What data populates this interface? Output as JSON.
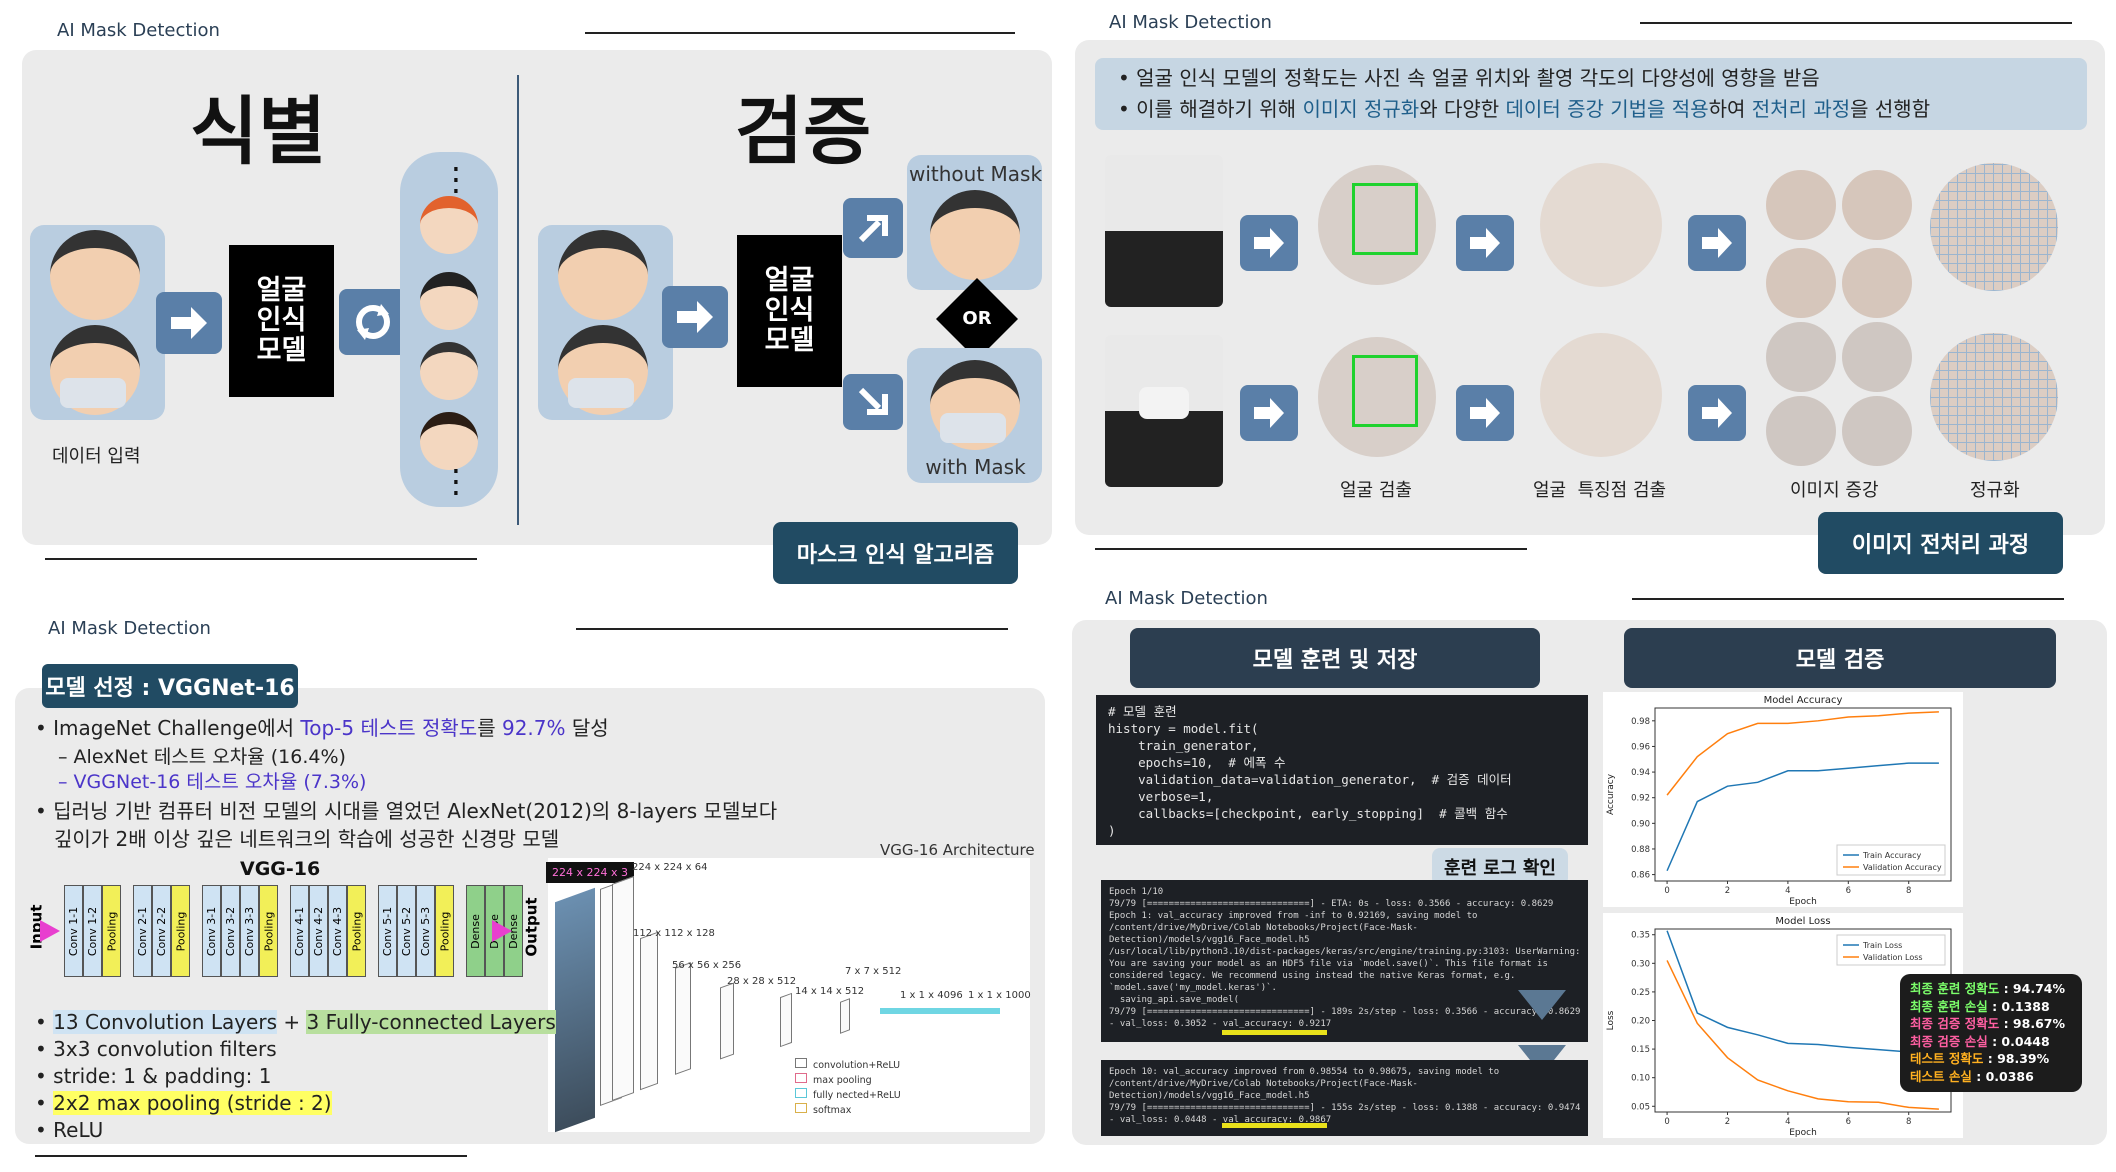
{
  "header_label": "AI Mask Detection",
  "q1": {
    "title_left": "식별",
    "title_right": "검증",
    "model_box": "얼굴\n인식\n모델",
    "data_input_label": "데이터 입력",
    "without_mask": "without Mask",
    "with_mask": "with Mask",
    "or_label": "OR",
    "dots": "⋮",
    "footer_button": "마스크 인식 알고리즘"
  },
  "q2": {
    "bullet1": "얼굴 인식 모델의 정확도는 사진 속 얼굴 위치와 촬영 각도의 다양성에 영향을 받음",
    "bullet2_parts": [
      "이를 해결하기 위해 ",
      "이미지 정규화",
      "와 다양한 ",
      "데이터 증강 기법을 적용",
      "하여 ",
      "전처리 과정",
      "을 선행함"
    ],
    "labels": [
      "얼굴 검출",
      "얼굴  특징점 검출",
      "이미지 증강",
      "정규화"
    ],
    "footer_button": "이미지 전처리 과정",
    "colors": {
      "highlight": "#1f5f8b"
    }
  },
  "q3": {
    "model_title": "모델 선정 : VGGNet-16",
    "b1_parts": [
      "ImageNet Challenge에서 ",
      "Top-5 테스트 정확도",
      "를 ",
      "92.7%",
      " 달성"
    ],
    "sub1": "AlexNet 테스트 오차율 (16.4%)",
    "sub2": "VGGNet-16 테스트 오차율 (7.3%)",
    "b2_line1": "딥러닝 기반 컴퓨터 비전 모델의 시대를 열었던 AlexNet(2012)의 8-layers 모델보다",
    "b2_line2": "깊이가 2배 이상 깊은 네트워크의 학습에 성공한 신경망 모델",
    "vgg_title": "VGG-16",
    "arch_title": "VGG-16 Architecture",
    "input_label": "Input",
    "output_label": "Output",
    "layers": [
      {
        "name": "Conv 1-1",
        "kind": "conv"
      },
      {
        "name": "Conv 1-2",
        "kind": "conv"
      },
      {
        "name": "Pooling",
        "kind": "pool"
      },
      {
        "name": "Conv 2-1",
        "kind": "conv"
      },
      {
        "name": "Conv 2-2",
        "kind": "conv"
      },
      {
        "name": "Pooling",
        "kind": "pool"
      },
      {
        "name": "Conv 3-1",
        "kind": "conv"
      },
      {
        "name": "Conv 3-2",
        "kind": "conv"
      },
      {
        "name": "Conv 3-3",
        "kind": "conv"
      },
      {
        "name": "Pooling",
        "kind": "pool"
      },
      {
        "name": "Conv 4-1",
        "kind": "conv"
      },
      {
        "name": "Conv 4-2",
        "kind": "conv"
      },
      {
        "name": "Conv 4-3",
        "kind": "conv"
      },
      {
        "name": "Pooling",
        "kind": "pool"
      },
      {
        "name": "Conv 5-1",
        "kind": "conv"
      },
      {
        "name": "Conv 5-2",
        "kind": "conv"
      },
      {
        "name": "Conv 5-3",
        "kind": "conv"
      },
      {
        "name": "Pooling",
        "kind": "pool"
      },
      {
        "name": "Dense",
        "kind": "dense"
      },
      {
        "name": "Dense",
        "kind": "dense"
      },
      {
        "name": "Dense",
        "kind": "dense"
      }
    ],
    "arch_dims": [
      "224 x 224 x 3",
      "224 x 224 x 64",
      "112 x 112 x 128",
      "56 x 56 x 256",
      "28 x 28 x 512",
      "14 x 14 x 512",
      "7 x 7 x 512",
      "1 x 1 x 4096",
      "1 x 1 x 1000"
    ],
    "legend": [
      "convolution+ReLU",
      "max pooling",
      "fully nected+ReLU",
      "softmax"
    ],
    "b3_a": "13 Convolution Layers",
    "b3_plus": " + ",
    "b3_b": "3 Fully-connected Layers",
    "b4": "3x3 convolution filters",
    "b5": "stride: 1 & padding: 1",
    "b6": "2x2 max pooling (stride : 2)",
    "b7": "ReLU"
  },
  "q4": {
    "btn_train": "모델 훈련 및 저장",
    "btn_verify": "모델 검증",
    "code": "# 모델 훈련\nhistory = model.fit(\n    train_generator,\n    epochs=10,  # 에폭 수\n    validation_data=validation_generator,  # 검증 데이터\n    verbose=1,\n    callbacks=[checkpoint, early_stopping]  # 콜백 함수\n)",
    "log_button": "훈련 로그 확인",
    "log1": "Epoch 1/10\n79/79 [==============================] - ETA: 0s - loss: 0.3566 - accuracy: 0.8629\nEpoch 1: val_accuracy improved from -inf to 0.92169, saving model to\n/content/drive/MyDrive/Colab Notebooks/Project(Face-Mask-\nDetection)/models/vgg16_Face_model.h5\n/usr/local/lib/python3.10/dist-packages/keras/src/engine/training.py:3103: UserWarning:\nYou are saving your model as an HDF5 file via `model.save()`. This file format is\nconsidered legacy. We recommend using instead the native Keras format, e.g.\n`model.save('my_model.keras')`.\n  saving_api.save_model(\n79/79 [==============================] - 189s 2s/step - loss: 0.3566 - accuracy: 0.8629\n- val_loss: 0.3052 - val_accuracy: 0.9217",
    "log2": "Epoch 10: val_accuracy improved from 0.98554 to 0.98675, saving model to\n/content/drive/MyDrive/Colab Notebooks/Project(Face-Mask-\nDetection)/models/vgg16_Face_model.h5\n79/79 [==============================] - 155s 2s/step - loss: 0.1388 - accuracy: 0.9474\n- val_loss: 0.0448 - val_accuracy: 0.9867",
    "metrics": [
      {
        "label": "최종 훈련 정확도",
        "value": "94.74%",
        "color": "#7cff6b"
      },
      {
        "label": "최종 훈련 손실",
        "value": "0.1388",
        "color": "#7cff6b"
      },
      {
        "label": "최종 검증 정확도",
        "value": "98.67%",
        "color": "#ff5fa2"
      },
      {
        "label": "최종 검증 손실",
        "value": "0.0448",
        "color": "#ff5fa2"
      },
      {
        "label": "테스트 정확도",
        "value": "98.39%",
        "color": "#ffb020"
      },
      {
        "label": "테스트 손실",
        "value": "0.0386",
        "color": "#ffb020"
      }
    ]
  },
  "chart_data": [
    {
      "type": "line",
      "title": "Model Accuracy",
      "xlabel": "Epoch",
      "ylabel": "Accuracy",
      "x": [
        0,
        1,
        2,
        3,
        4,
        5,
        6,
        7,
        8,
        9
      ],
      "xticks": [
        0,
        2,
        4,
        6,
        8
      ],
      "yticks": [
        0.86,
        0.88,
        0.9,
        0.92,
        0.94,
        0.96,
        0.98
      ],
      "ylim": [
        0.855,
        0.99
      ],
      "legend_position": "lower-right",
      "series": [
        {
          "name": "Train Accuracy",
          "color": "#1f77b4",
          "values": [
            0.863,
            0.917,
            0.929,
            0.932,
            0.941,
            0.941,
            0.943,
            0.945,
            0.947,
            0.947
          ]
        },
        {
          "name": "Validation Accuracy",
          "color": "#ff7f0e",
          "values": [
            0.922,
            0.952,
            0.97,
            0.978,
            0.978,
            0.98,
            0.983,
            0.984,
            0.986,
            0.987
          ]
        }
      ]
    },
    {
      "type": "line",
      "title": "Model Loss",
      "xlabel": "Epoch",
      "ylabel": "Loss",
      "x": [
        0,
        1,
        2,
        3,
        4,
        5,
        6,
        7,
        8,
        9
      ],
      "xticks": [
        0,
        2,
        4,
        6,
        8
      ],
      "yticks": [
        0.05,
        0.1,
        0.15,
        0.2,
        0.25,
        0.3,
        0.35
      ],
      "ylim": [
        0.04,
        0.36
      ],
      "legend_position": "upper-right",
      "series": [
        {
          "name": "Train Loss",
          "color": "#1f77b4",
          "values": [
            0.357,
            0.213,
            0.188,
            0.175,
            0.16,
            0.158,
            0.153,
            0.149,
            0.145,
            0.139
          ]
        },
        {
          "name": "Validation Loss",
          "color": "#ff7f0e",
          "values": [
            0.305,
            0.195,
            0.135,
            0.096,
            0.077,
            0.063,
            0.058,
            0.057,
            0.048,
            0.045
          ]
        }
      ]
    }
  ]
}
